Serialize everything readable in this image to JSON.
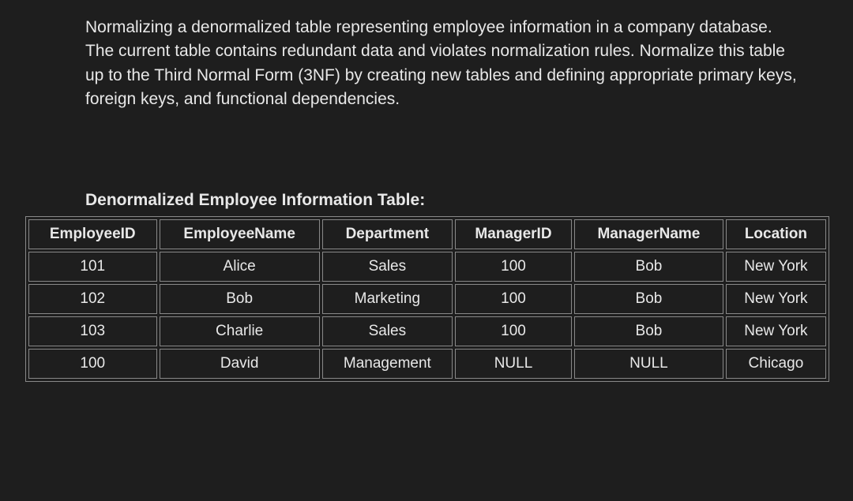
{
  "description": "Normalizing a denormalized table representing employee information in a company database. The current table contains redundant data and violates normalization rules. Normalize this table up to the Third Normal Form (3NF) by creating new tables and defining appropriate primary keys, foreign keys, and functional dependencies.",
  "table_title": "Denormalized Employee Information Table:",
  "headers": [
    "EmployeeID",
    "EmployeeName",
    "Department",
    "ManagerID",
    "ManagerName",
    "Location"
  ],
  "rows": [
    [
      "101",
      "Alice",
      "Sales",
      "100",
      "Bob",
      "New York"
    ],
    [
      "102",
      "Bob",
      "Marketing",
      "100",
      "Bob",
      "New York"
    ],
    [
      "103",
      "Charlie",
      "Sales",
      "100",
      "Bob",
      "New York"
    ],
    [
      "100",
      "David",
      "Management",
      "NULL",
      "NULL",
      "Chicago"
    ]
  ]
}
